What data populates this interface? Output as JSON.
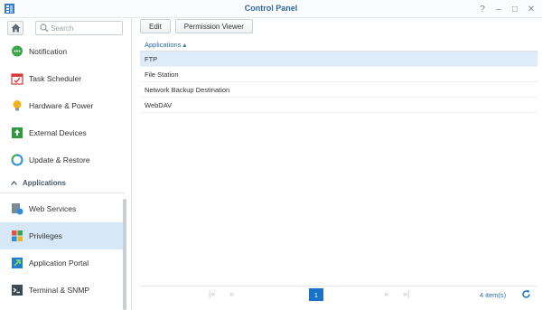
{
  "window": {
    "title": "Control Panel",
    "controls": [
      {
        "name": "help-icon",
        "glyph": "?"
      },
      {
        "name": "minimize-icon",
        "glyph": "–"
      },
      {
        "name": "maximize-icon",
        "glyph": "□"
      },
      {
        "name": "close-icon",
        "glyph": "✕"
      }
    ]
  },
  "sidebar": {
    "search_placeholder": "Search",
    "items": [
      {
        "label": "Notification",
        "icon": "notification-icon"
      },
      {
        "label": "Task Scheduler",
        "icon": "task-scheduler-icon"
      },
      {
        "label": "Hardware & Power",
        "icon": "hardware-power-icon"
      },
      {
        "label": "External Devices",
        "icon": "external-devices-icon"
      },
      {
        "label": "Update & Restore",
        "icon": "update-restore-icon"
      }
    ],
    "section": {
      "label": "Applications"
    },
    "app_items": [
      {
        "label": "Web Services",
        "icon": "web-services-icon"
      },
      {
        "label": "Privileges",
        "icon": "privileges-icon",
        "active": true
      },
      {
        "label": "Application Portal",
        "icon": "application-portal-icon"
      },
      {
        "label": "Terminal & SNMP",
        "icon": "terminal-snmp-icon"
      }
    ]
  },
  "toolbar": {
    "edit_label": "Edit",
    "permission_viewer_label": "Permission Viewer"
  },
  "grid": {
    "column_header": "Applications ▴",
    "rows": [
      "FTP",
      "File Station",
      "Network Backup Destination",
      "WebDAV"
    ],
    "selected_index": 0
  },
  "pager": {
    "current_page": "1",
    "count_text": "4 item(s)"
  },
  "colors": {
    "accent": "#1a73c6",
    "title": "#2d6aa3",
    "selected_row": "#ddecf8",
    "active_nav": "#d6e8f7"
  }
}
